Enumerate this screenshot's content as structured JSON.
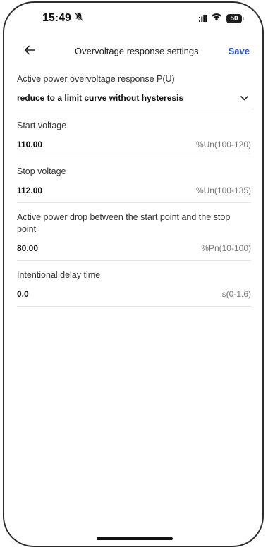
{
  "status_bar": {
    "time": "15:49",
    "battery": "50",
    "signal_text": ":ıll",
    "wifi_icon": "wifi-icon",
    "silent_icon": "bell-slash-icon"
  },
  "header": {
    "title": "Overvoltage response settings",
    "save_label": "Save",
    "back_icon": "arrow-left-icon"
  },
  "fields": [
    {
      "label": "Active power overvoltage response P(U)",
      "value": "reduce to a limit curve without hysteresis",
      "type": "dropdown"
    },
    {
      "label": "Start voltage",
      "value": "110.00",
      "range": "%Un(100-120)"
    },
    {
      "label": "Stop voltage",
      "value": "112.00",
      "range": "%Un(100-135)"
    },
    {
      "label": "Active power drop between the start point and the stop point",
      "value": "80.00",
      "range": "%Pn(10-100)"
    },
    {
      "label": "Intentional delay time",
      "value": "0.0",
      "range": "s(0-1.6)"
    }
  ],
  "colors": {
    "accent": "#1e4fd8",
    "divider": "#e6e6e6"
  }
}
